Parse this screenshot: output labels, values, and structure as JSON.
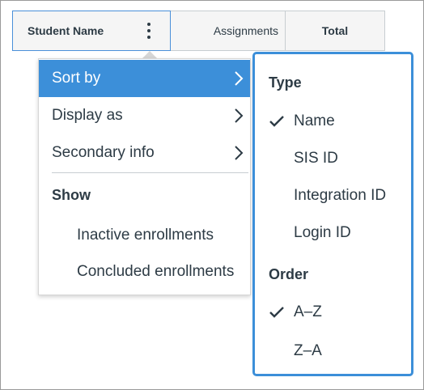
{
  "grid": {
    "columns": [
      {
        "id": "student",
        "label": "Student Name"
      },
      {
        "id": "assignments",
        "label": "Assignments"
      },
      {
        "id": "total",
        "label": "Total"
      }
    ]
  },
  "menu": {
    "items": [
      {
        "label": "Sort by",
        "active": true
      },
      {
        "label": "Display as"
      },
      {
        "label": "Secondary info"
      }
    ],
    "show_group": "Show",
    "show_items": [
      "Inactive enrollments",
      "Concluded enrollments"
    ]
  },
  "submenu": {
    "type_group": "Type",
    "type_items": [
      {
        "label": "Name",
        "checked": true
      },
      {
        "label": "SIS ID",
        "checked": false
      },
      {
        "label": "Integration ID",
        "checked": false
      },
      {
        "label": "Login ID",
        "checked": false
      }
    ],
    "order_group": "Order",
    "order_items": [
      {
        "label": "A–Z",
        "checked": true
      },
      {
        "label": "Z–A",
        "checked": false
      }
    ]
  },
  "colors": {
    "accent": "#3c8fd9",
    "text": "#2d3b45",
    "header_bg": "#f5f5f5"
  },
  "icons": [
    "kebab-menu-icon",
    "chevron-right-icon",
    "checkmark-icon"
  ]
}
